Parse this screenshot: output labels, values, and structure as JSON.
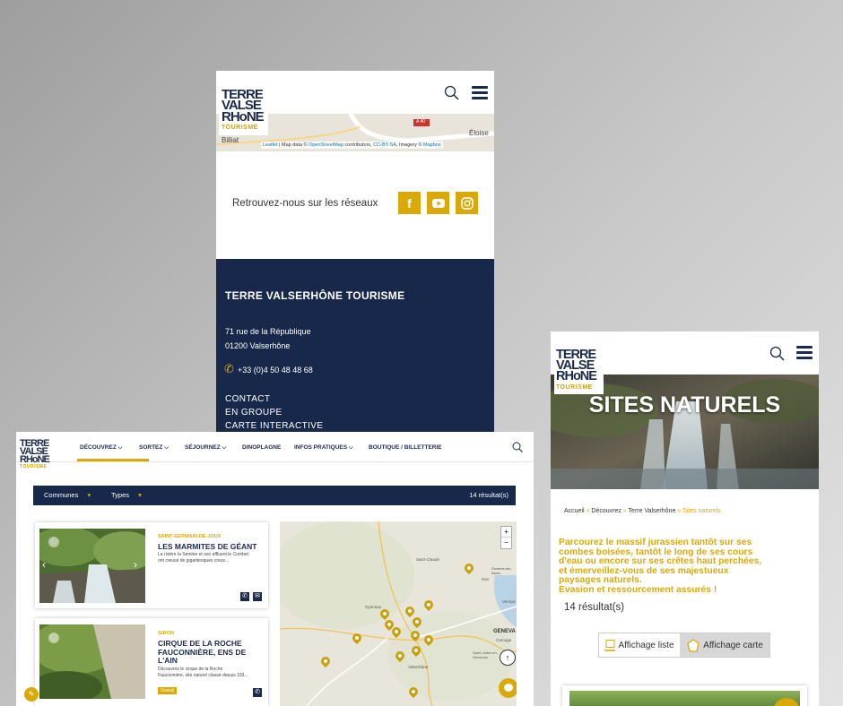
{
  "brand": {
    "logo_lines": [
      "TERRE",
      "VALSE",
      "RHoNE"
    ],
    "logo_tag": "TOURISME",
    "accent": "#d9a90a",
    "navy": "#17284a"
  },
  "phone1": {
    "map_place_left": "Billiat",
    "map_place_right": "Éloise",
    "map_road_label": "A 40",
    "map_attribution_leaflet": "Leaflet",
    "map_attribution_mid": "| Map data ©",
    "map_attribution_osm": "OpenStreetMap",
    "map_attribution_contrib": "contributors,",
    "map_attribution_cc": "CC-BY-SA",
    "map_attribution_imagery": ", Imagery ©",
    "map_attribution_mapbox": "Mapbox",
    "social_text": "Retrouvez-nous sur les réseaux",
    "footer": {
      "title": "TERRE VALSERHÔNE TOURISME",
      "address1": "71 rue de la République",
      "address2": "01200 Valserhône",
      "phone": "+33 (0)4 50 48 48 68",
      "links": [
        "CONTACT",
        "EN GROUPE",
        "CARTE INTERACTIVE"
      ]
    }
  },
  "desktop": {
    "nav": [
      "DÉCOUVREZ",
      "SORTEZ",
      "SÉJOURNEZ",
      "DINOPLAGNE",
      "INFOS PRATIQUES",
      "BOUTIQUE / BILLETTERIE"
    ],
    "filter": {
      "communes": "Communes",
      "types": "Types",
      "results": "14 résultat(s)"
    },
    "cards": [
      {
        "location": "SAINT-GERMAIN-DE-JOUX",
        "title": "LES MARMITES DE GÉANT",
        "desc_line1": "La rivière la Semine et son affluent le Combet",
        "desc_line2": "ont creusé de gigantesques creux..."
      },
      {
        "location": "GIRON",
        "title_line1": "CIRQUE DE LA ROCHE",
        "title_line2": "FAUCONNIÈRE, ENS DE",
        "title_line3": "L'AIN",
        "desc_line1": "Découvrez le cirque de la Roche",
        "desc_line2": "Fauconnière, site naturel classé depuis 193...",
        "badge": "Gratuit"
      }
    ],
    "map_labels": {
      "saint_claude": "Saint-Claude",
      "divonne": "Divonne-les-Bains",
      "gex": "Gex",
      "oyonnax": "Oyonnax",
      "geneva": "GENEVA",
      "carouge": "Carouge",
      "valserhone": "Valserhône",
      "saint_julien": "Saint-Julien-en-Genevois",
      "versoix": "Versoix"
    },
    "zoom_in": "+",
    "zoom_out": "−"
  },
  "phone2": {
    "hero_title": "SITES NATURELS",
    "breadcrumb": {
      "home": "Accueil",
      "sep": "»",
      "level1": "Découvrez",
      "level2": "Terre Valserhône",
      "current": "Sites naturels"
    },
    "intro_line1": "Parcourez le massif jurassien tantôt sur ses",
    "intro_line2": "combes boisées, tantôt le long de ses cours",
    "intro_line3": "d'eau ou encore sur ses crêtes haut perchées,",
    "intro_line4": "et émerveillez-vous de ses majestueux",
    "intro_line5": "paysages naturels.",
    "intro_line6": "Evasion et ressourcement assurés !",
    "results": "14 résultat(s)",
    "btn_list": "Affichage liste",
    "btn_map": "Affichage carte"
  }
}
